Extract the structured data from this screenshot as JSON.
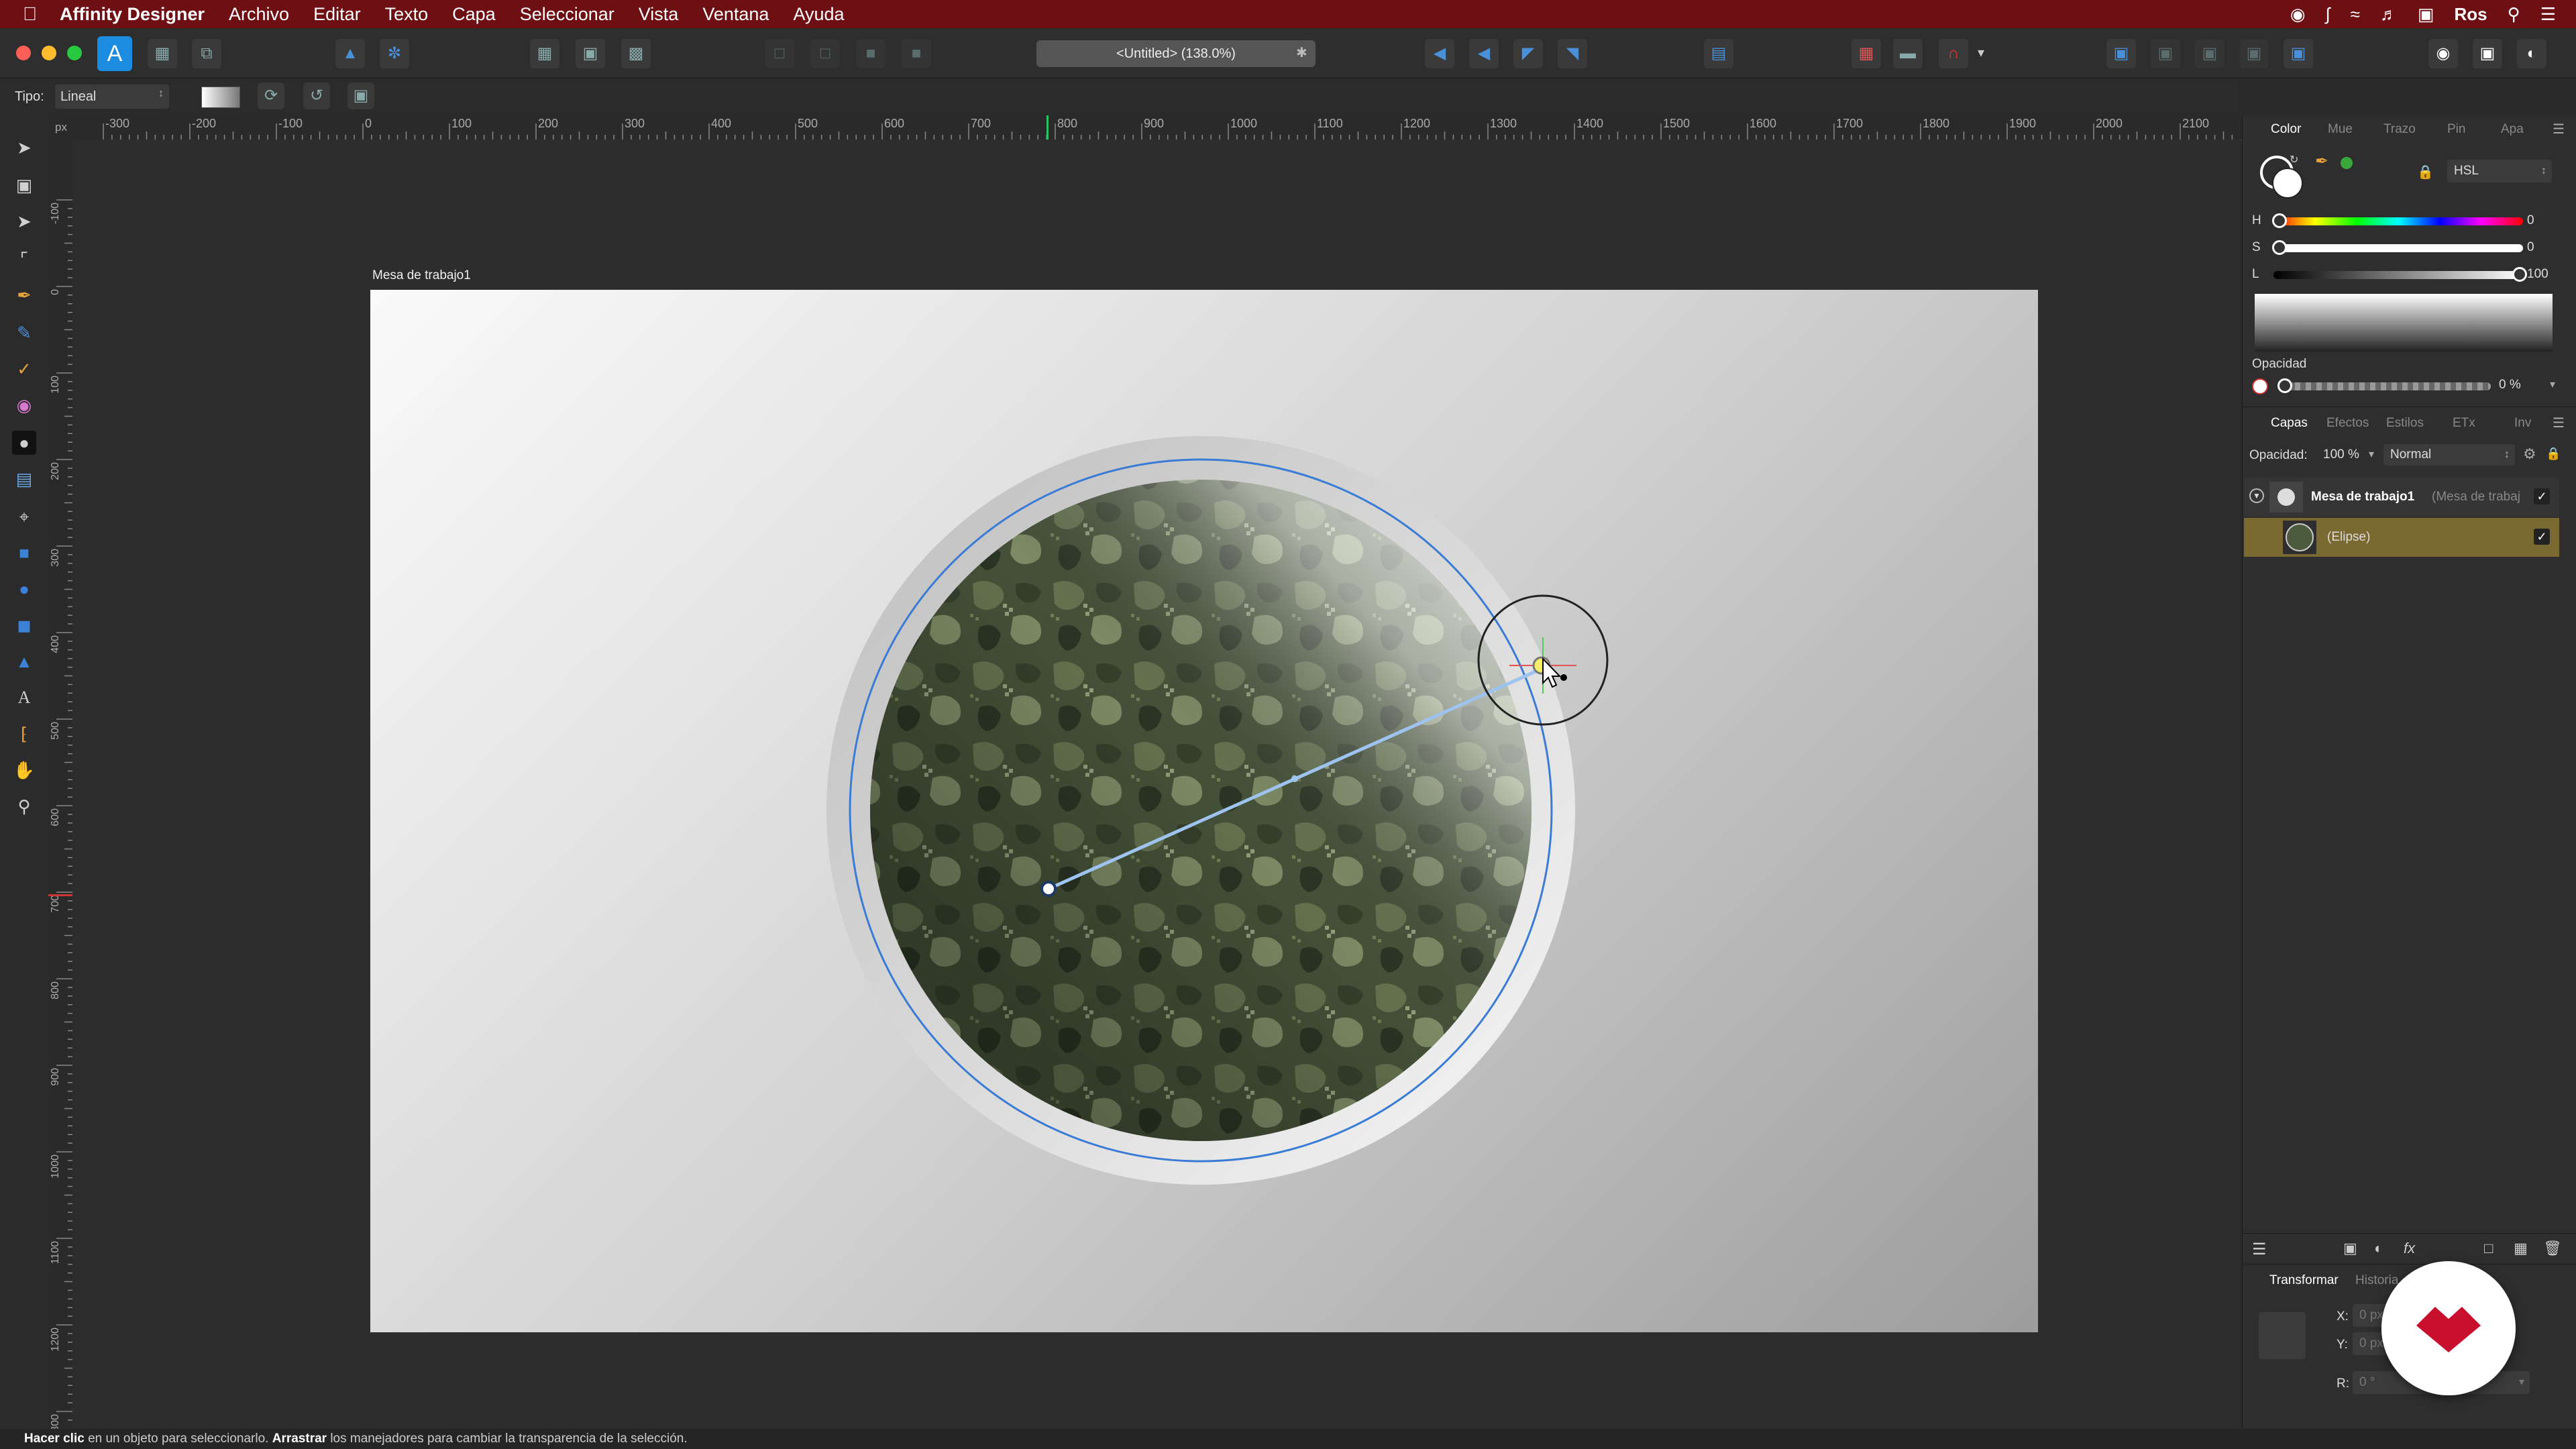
{
  "menubar": {
    "app_name": "Affinity Designer",
    "items": [
      "Archivo",
      "Editar",
      "Texto",
      "Capa",
      "Seleccionar",
      "Vista",
      "Ventana",
      "Ayuda"
    ],
    "user": "Ros"
  },
  "document": {
    "title": "<Untitled> (138.0%)"
  },
  "context": {
    "type_label": "Tipo:",
    "type_value": "Lineal"
  },
  "ruler": {
    "unit": "px",
    "h_ticks": [
      "-300",
      "-200",
      "-100",
      "0",
      "100",
      "200",
      "300",
      "400",
      "500",
      "600",
      "700",
      "800",
      "900",
      "1000",
      "1100",
      "1200",
      "1300",
      "1400",
      "1500",
      "1600",
      "1700",
      "1800",
      "1900",
      "2000",
      "2100"
    ],
    "v_ticks": [
      "-100",
      "0",
      "100",
      "200",
      "300",
      "400",
      "500",
      "600",
      "700",
      "800",
      "900",
      "1000",
      "1100",
      "1200",
      "1300"
    ]
  },
  "artboard": {
    "label": "Mesa de trabajo1"
  },
  "color_panel": {
    "tabs": [
      "Color",
      "Mue",
      "Trazo",
      "Pin",
      "Apa"
    ],
    "mode": "HSL",
    "h_label": "H",
    "h_value": "0",
    "s_label": "S",
    "s_value": "0",
    "l_label": "L",
    "l_value": "100",
    "opacity_label": "Opacidad",
    "opacity_value": "0 %"
  },
  "layers_panel": {
    "tabs": [
      "Capas",
      "Efectos",
      "Estilos",
      "ETx",
      "Inv"
    ],
    "opacity_label": "Opacidad:",
    "opacity_value": "100 %",
    "blend_mode": "Normal",
    "layers": [
      {
        "name": "Mesa de trabajo1",
        "detail": "(Mesa de trabaj"
      },
      {
        "name": "(Elipse)"
      }
    ]
  },
  "transform_panel": {
    "tabs": [
      "Transformar",
      "Historia"
    ],
    "x_label": "X:",
    "x_value": "0 px",
    "y_label": "Y:",
    "y_value": "0 px",
    "r_label": "R:",
    "r_value": "0 °"
  },
  "status": {
    "click": "Hacer clic",
    "click_text": " en un objeto para seleccionarlo. ",
    "drag": "Arrastrar",
    "drag_text": " los manejadores para cambiar la transparencia de la selección."
  },
  "colors": {
    "menubar_bg": "#6e0f14",
    "accent": "#4a90d9",
    "selected_layer": "#7a6a32",
    "brand": "#c8102e"
  }
}
